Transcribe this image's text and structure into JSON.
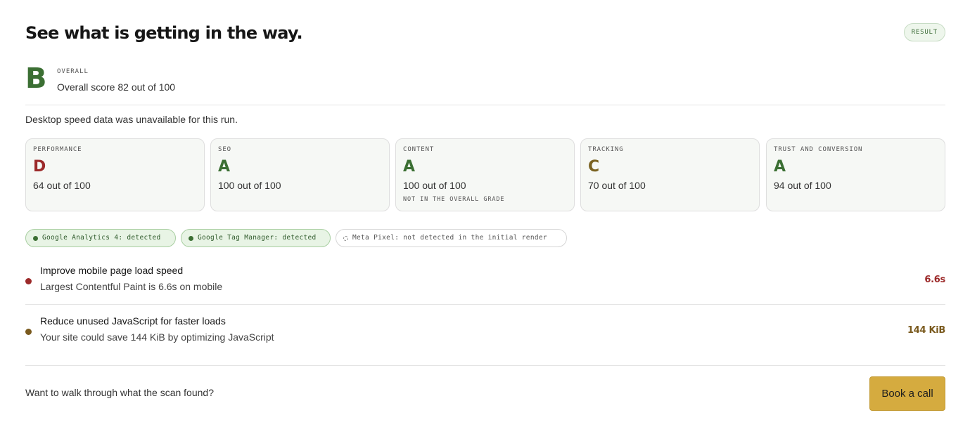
{
  "header": {
    "title": "See what is getting in the way.",
    "badge": "RESULT"
  },
  "overall": {
    "grade": "B",
    "label": "OVERALL",
    "score_text": "Overall score 82 out of 100"
  },
  "note": "Desktop speed data was unavailable for this run.",
  "categories": [
    {
      "label": "PERFORMANCE",
      "grade": "D",
      "score_text": "64 out of 100",
      "note": "",
      "color": "#9c2a2a"
    },
    {
      "label": "SEO",
      "grade": "A",
      "score_text": "100 out of 100",
      "note": "",
      "color": "#3b6f33"
    },
    {
      "label": "CONTENT",
      "grade": "A",
      "score_text": "100 out of 100",
      "note": "NOT IN THE OVERALL GRADE",
      "color": "#3b6f33"
    },
    {
      "label": "TRACKING",
      "grade": "C",
      "score_text": "70 out of 100",
      "note": "",
      "color": "#7a6221"
    },
    {
      "label": "TRUST AND CONVERSION",
      "grade": "A",
      "score_text": "94 out of 100",
      "note": "",
      "color": "#3b6f33"
    }
  ],
  "tracking_pills": [
    {
      "text": "Google Analytics 4: detected",
      "state": "detected"
    },
    {
      "text": "Google Tag Manager: detected",
      "state": "detected"
    },
    {
      "text": "Meta Pixel: not detected in the initial render",
      "state": "not-detected"
    }
  ],
  "issues": [
    {
      "title": "Improve mobile page load speed",
      "description": "Largest Contentful Paint is 6.6s on mobile",
      "metric": "6.6s",
      "color": "#9c2a2a"
    },
    {
      "title": "Reduce unused JavaScript for faster loads",
      "description": "Your site could save 144 KiB by optimizing JavaScript",
      "metric": "144 KiB",
      "color": "#7a5a1e"
    }
  ],
  "footer": {
    "text": "Want to walk through what the scan found?",
    "button_label": "Book a call",
    "button_color": "#d5ab3f"
  }
}
